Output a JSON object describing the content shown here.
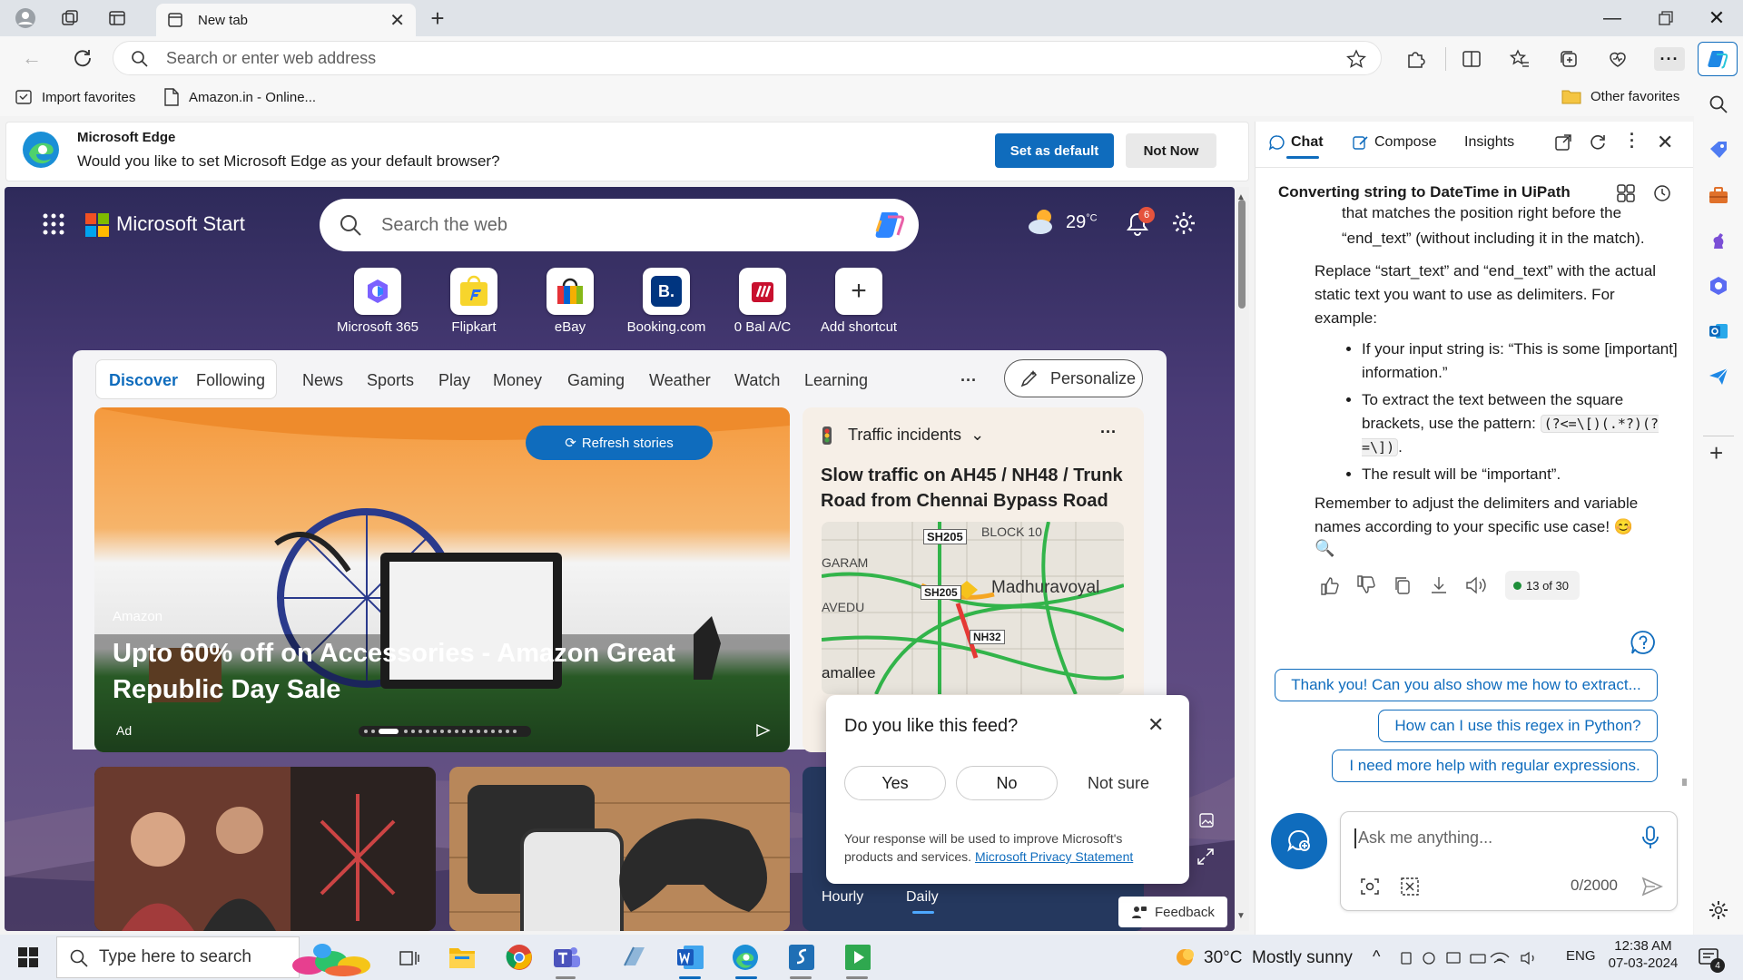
{
  "browser": {
    "tab_title": "New tab",
    "address_placeholder": "Search or enter web address",
    "favorites": [
      "Import favorites",
      "Amazon.in - Online..."
    ],
    "other_favorites": "Other favorites"
  },
  "infobar": {
    "title": "Microsoft Edge",
    "message": "Would you like to set Microsoft Edge as your default browser?",
    "set_default": "Set as default",
    "not_now": "Not Now"
  },
  "start": {
    "brand": "Microsoft Start",
    "search_placeholder": "Search the web",
    "temperature": "29",
    "temp_unit": "°C",
    "notif_count": "6",
    "shortcuts": [
      "Microsoft 365",
      "Flipkart",
      "eBay",
      "Booking.com",
      "0 Bal A/C",
      "Add shortcut"
    ],
    "nav": [
      "Discover",
      "Following",
      "News",
      "Sports",
      "Play",
      "Money",
      "Gaming",
      "Weather",
      "Watch",
      "Learning"
    ],
    "more": "···",
    "personalize": "Personalize",
    "refresh": "Refresh stories",
    "hero_source": "Amazon",
    "hero_title": "Upto 60% off on Accessories - Amazon Great Republic Day Sale",
    "ad_label": "Ad",
    "traffic_header": "Traffic incidents",
    "traffic_title": "Slow traffic on AH45 / NH48 / Trunk Road from Chennai Bypass Road to...",
    "map_labels": [
      "SH205",
      "BLOCK 10",
      "GARAM",
      "Madhuravoyal",
      "SH205",
      "AVEDU",
      "NH32",
      "amallee"
    ],
    "weather_tabs": [
      "Hourly",
      "Daily"
    ],
    "feedback": "Feedback"
  },
  "feed_dialog": {
    "question": "Do you like this feed?",
    "yes": "Yes",
    "no": "No",
    "not_sure": "Not sure",
    "note": "Your response will be used to improve Microsoft's products and services.",
    "link": "Microsoft Privacy Statement"
  },
  "copilot": {
    "tabs": [
      "Chat",
      "Compose",
      "Insights"
    ],
    "title": "Converting string to DateTime in UiPath",
    "partial_line1": "that matches the position right before the",
    "partial_line2": "“end_text” (without including it in the match).",
    "para1": "Replace “start_text” and “end_text” with the actual static text you want to use as delimiters. For example:",
    "bullet1": "If your input string is: “This is some [important] information.”",
    "bullet2_prefix": "To extract the text between the square brackets, use the pattern:",
    "bullet2_code": "(?<=\\[)(.*?)(?=\\])",
    "bullet2_suffix": ".",
    "bullet3": "The result will be “important”.",
    "para2": "Remember to adjust the delimiters and variable names according to your specific use case! 😊",
    "magnifier": "🔍",
    "counter": "13 of 30",
    "suggestions": [
      "Thank you! Can you also show me how to extract...",
      "How can I use this regex in Python?",
      "I need more help with regular expressions."
    ],
    "input_placeholder": "Ask me anything...",
    "char_count": "0/2000"
  },
  "taskbar": {
    "search_placeholder": "Type here to search",
    "weather": "30°C  Mostly sunny",
    "lang": "ENG",
    "time": "12:38 AM",
    "date": "07-03-2024",
    "notif": "4"
  },
  "colors": {
    "accent": "#0f6cbd",
    "copilot_blue": "#0f6cbd",
    "badge": "#e5533d"
  }
}
